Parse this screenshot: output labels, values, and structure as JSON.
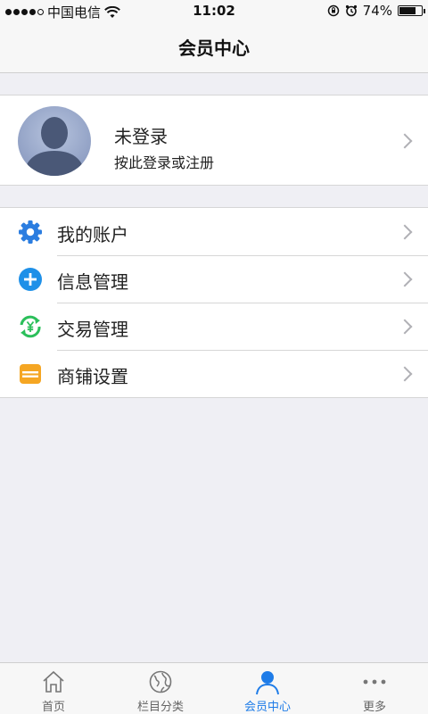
{
  "status_bar": {
    "carrier": "中国电信",
    "time": "11:02",
    "battery_percent_text": "74%",
    "battery_level": 0.74
  },
  "nav": {
    "title": "会员中心"
  },
  "profile": {
    "name": "未登录",
    "hint": "按此登录或注册"
  },
  "menu": {
    "items": [
      {
        "label": "我的账户",
        "icon": "gear-icon"
      },
      {
        "label": "信息管理",
        "icon": "plus-circle-icon"
      },
      {
        "label": "交易管理",
        "icon": "yen-exchange-icon"
      },
      {
        "label": "商铺设置",
        "icon": "shop-icon"
      }
    ]
  },
  "tabs": {
    "items": [
      {
        "label": "首页",
        "icon": "home-icon",
        "active": false
      },
      {
        "label": "栏目分类",
        "icon": "globe-icon",
        "active": false
      },
      {
        "label": "会员中心",
        "icon": "person-icon",
        "active": true
      },
      {
        "label": "更多",
        "icon": "more-icon",
        "active": false
      }
    ]
  },
  "colors": {
    "accent": "#1e7ce8",
    "gear": "#2b7de0",
    "plus": "#1e90e8",
    "exchange": "#2bbf5a",
    "shop": "#f5a623",
    "background": "#efeff4"
  }
}
